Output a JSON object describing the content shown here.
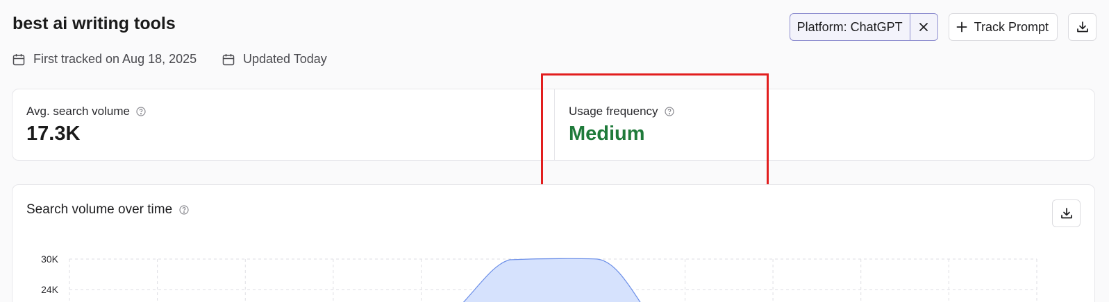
{
  "page": {
    "title": "best ai writing tools",
    "first_tracked": "First tracked on Aug 18, 2025",
    "updated": "Updated Today"
  },
  "toolbar": {
    "platform_label": "Platform:",
    "platform_value": "ChatGPT",
    "track_label": "Track Prompt",
    "icons": {
      "close": "close-icon",
      "plus": "plus-icon",
      "download": "download-icon"
    }
  },
  "stats": {
    "search_volume": {
      "label": "Avg. search volume",
      "value": "17.3K"
    },
    "usage_frequency": {
      "label": "Usage frequency",
      "value": "Medium",
      "value_color": "#1f7a3a"
    }
  },
  "chart_data": {
    "type": "area",
    "title": "Search volume over time",
    "y_ticks": [
      "30K",
      "24K"
    ],
    "ylim": [
      0,
      30000
    ],
    "grid": true,
    "color": "#6c8fe8",
    "fill": "#d6e2fd"
  },
  "colors": {
    "accent_border": "#8f8fd0",
    "highlight": "#e21e1e"
  }
}
